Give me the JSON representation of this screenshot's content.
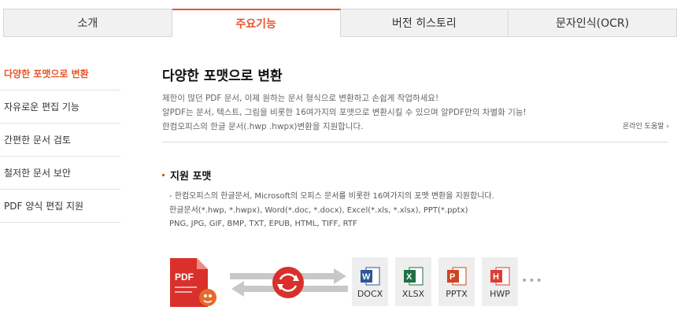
{
  "tabs": [
    {
      "label": "소개"
    },
    {
      "label": "주요기능"
    },
    {
      "label": "버전 히스토리"
    },
    {
      "label": "문자인식(OCR)"
    }
  ],
  "sidebar": {
    "items": [
      {
        "label": "다양한 포맷으로 변환"
      },
      {
        "label": "자유로운 편집 기능"
      },
      {
        "label": "간편한 문서 검토"
      },
      {
        "label": "철저한 문서 보안"
      },
      {
        "label": "PDF 양식 편집 지원"
      }
    ]
  },
  "main": {
    "title": "다양한 포맷으로 변환",
    "desc_lines": [
      "제한이 많던 PDF 문서, 이제 원하는 문서 형식으로 변환하고 손쉽게 작업하세요!",
      "알PDF는 문서, 텍스트, 그림을 비롯한 16여가지의 포맷으로 변환시킬 수 있으며 알PDF만의 차별화 기능!",
      "한컴오피스의 한글 문서(.hwp .hwpx)변환을 지원합니다."
    ],
    "help_link": "온라인 도움말 ›",
    "support": {
      "title": "지원 포맷",
      "lines": [
        "- 한컴오피스의 한글문서, Microsoft의 오피스 문서를 비롯한 16여가지의 포맷 변환을 지원합니다.",
        "한글문서(*.hwp, *.hwpx), Word(*.doc, *.docx), Excel(*.xls, *.xlsx), PPT(*.pptx)",
        "PNG, JPG, GIF, BMP, TXT, EPUB, HTML, TIFF, RTF"
      ]
    }
  },
  "diagram": {
    "pdf_label": "PDF",
    "formats": [
      {
        "label": "DOCX",
        "letter": "W",
        "color": "#2b5797"
      },
      {
        "label": "XLSX",
        "letter": "X",
        "color": "#1e7145"
      },
      {
        "label": "PPTX",
        "letter": "P",
        "color": "#d04423"
      },
      {
        "label": "HWP",
        "letter": "H",
        "color": "#e03c31"
      }
    ],
    "more": "•••"
  },
  "colors": {
    "accent": "#e8542b",
    "convert_circle": "#d9302b"
  }
}
